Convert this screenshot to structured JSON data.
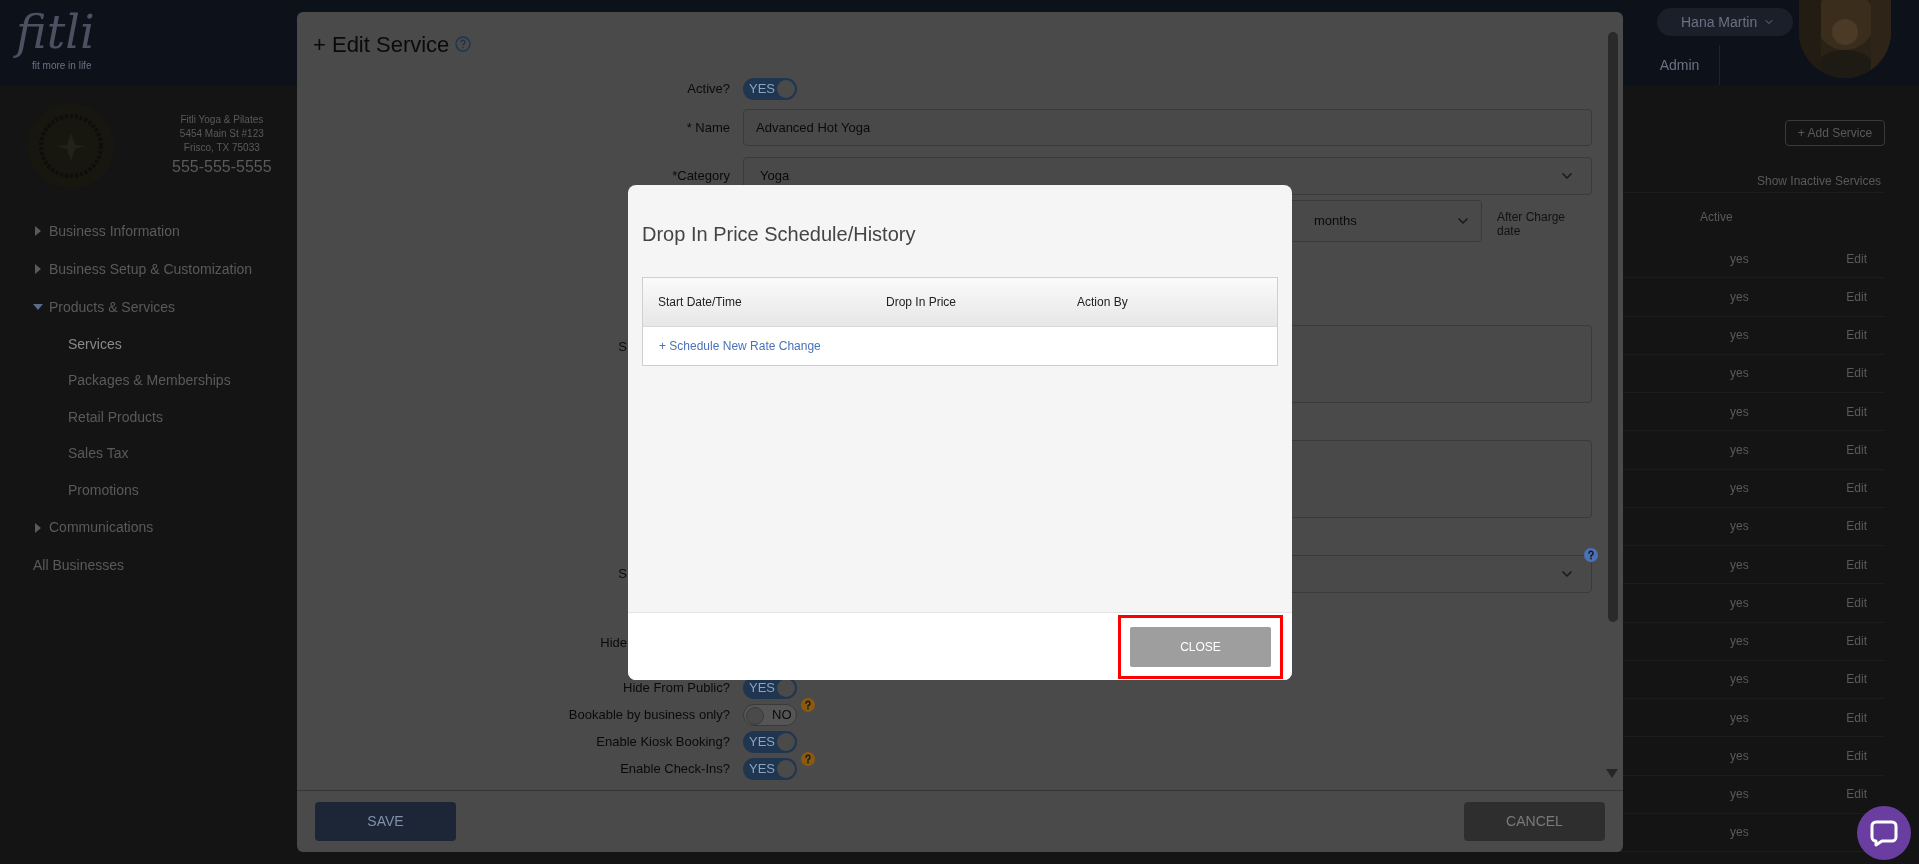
{
  "header": {
    "logo": "fitli",
    "tagline": "fit more in life",
    "user": "Hana Martin",
    "tab": "Admin"
  },
  "sidebar": {
    "business": [
      "Fitli Yoga & Pilates",
      "5454 Main St #123",
      "Frisco, TX 75033",
      "555-555-5555"
    ],
    "nav": [
      {
        "label": "Business Information",
        "kind": "section",
        "expanded": false
      },
      {
        "label": "Business Setup & Customization",
        "kind": "section",
        "expanded": false
      },
      {
        "label": "Products & Services",
        "kind": "section",
        "expanded": true,
        "children": [
          {
            "label": "Services",
            "selected": true
          },
          {
            "label": "Packages & Memberships",
            "selected": false
          },
          {
            "label": "Retail Products",
            "selected": false
          },
          {
            "label": "Sales Tax",
            "selected": false
          },
          {
            "label": "Promotions",
            "selected": false
          }
        ]
      },
      {
        "label": "Communications",
        "kind": "section",
        "expanded": false
      },
      {
        "label": "All Businesses",
        "kind": "link"
      }
    ]
  },
  "services_list": {
    "add_button": "+ Add Service",
    "filter": "Show Inactive Services",
    "column": "Active",
    "rows": [
      {
        "active": "yes",
        "action": "Edit"
      },
      {
        "active": "yes",
        "action": "Edit"
      },
      {
        "active": "yes",
        "action": "Edit"
      },
      {
        "active": "yes",
        "action": "Edit"
      },
      {
        "active": "yes",
        "action": "Edit"
      },
      {
        "active": "yes",
        "action": "Edit"
      },
      {
        "active": "yes",
        "action": "Edit"
      },
      {
        "active": "yes",
        "action": "Edit"
      },
      {
        "active": "yes",
        "action": "Edit"
      },
      {
        "active": "yes",
        "action": "Edit"
      },
      {
        "active": "yes",
        "action": "Edit"
      },
      {
        "active": "yes",
        "action": "Edit"
      },
      {
        "active": "yes",
        "action": "Edit"
      },
      {
        "active": "yes",
        "action": "Edit"
      },
      {
        "active": "yes",
        "action": "Edit"
      },
      {
        "active": "yes"
      }
    ]
  },
  "edit_service": {
    "title": "+ Edit Service",
    "fields": [
      {
        "kind": "toggle",
        "label": "Active?",
        "on": true,
        "value": "YES",
        "help": false
      },
      {
        "kind": "input",
        "label": "* Name",
        "value": "Advanced Hot Yoga"
      },
      {
        "kind": "select",
        "label": "*Category",
        "value": "Yoga",
        "help": false
      },
      {
        "kind": "select_note",
        "value": "months",
        "note": "After Charge date"
      },
      {
        "kind": "textarea",
        "label": "S"
      },
      {
        "kind": "textarea"
      },
      {
        "kind": "select",
        "label": "S",
        "help": true
      },
      {
        "kind": "label",
        "label": "Hide"
      },
      {
        "kind": "toggle",
        "label": "Hide From Public?",
        "on": true,
        "value": "YES",
        "help": false
      },
      {
        "kind": "toggle",
        "label": "Bookable by business only?",
        "on": false,
        "value": "NO",
        "help": true
      },
      {
        "kind": "toggle",
        "label": "Enable Kiosk Booking?",
        "on": true,
        "value": "YES",
        "help": false
      },
      {
        "kind": "toggle",
        "label": "Enable Check-Ins?",
        "on": true,
        "value": "YES",
        "help": true
      }
    ],
    "save": "SAVE",
    "cancel": "CANCEL"
  },
  "dialog": {
    "title": "Drop In Price Schedule/History",
    "columns": [
      "Start Date/Time",
      "Drop In Price",
      "Action By"
    ],
    "link": "+ Schedule New Rate Change",
    "close": "CLOSE",
    "close_highlighted": true
  }
}
